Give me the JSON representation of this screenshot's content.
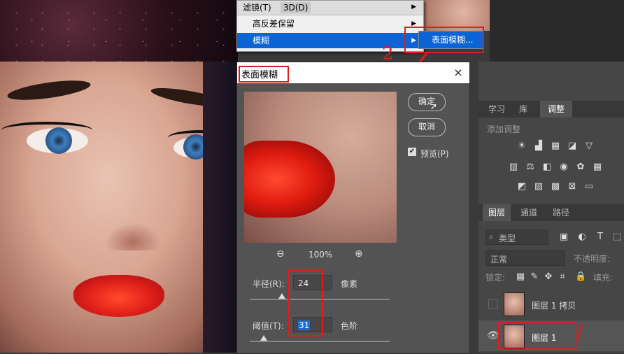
{
  "menu": {
    "filter_label": "滤镜(T)",
    "threed_label": "3D(D)",
    "items": [
      {
        "label": "高反差保留"
      },
      {
        "label": "模糊"
      }
    ],
    "submenu_label": "表面模糊..."
  },
  "annotations": {
    "step_two": "2",
    "layer_mark": "/"
  },
  "dialog": {
    "title": "表面模糊",
    "close": "×",
    "ok_label": "确定",
    "cancel_label": "取消",
    "preview_label": "预览(P)",
    "preview_checked": true,
    "zoom_out": "⊖",
    "zoom_in": "⊕",
    "zoom_level": "100%",
    "radius_label": "半径(R):",
    "radius_value": "24",
    "radius_unit": "像素",
    "radius_slider_fraction": 0.23,
    "threshold_label": "阈值(T):",
    "threshold_value": "31",
    "threshold_unit": "色阶",
    "threshold_slider_fraction": 0.1
  },
  "panels": {
    "tabs_top": [
      "学习",
      "库",
      "调整"
    ],
    "active_top_tab": "调整",
    "add_adjustment": "添加调整",
    "tabs_layers": [
      "图层",
      "通道",
      "路径"
    ],
    "active_layers_tab": "图层",
    "filter_kind": "类型",
    "blend_mode": "正常",
    "opacity_label": "不透明度:",
    "lock_label": "锁定:",
    "fill_label": "填充:",
    "layers": [
      {
        "name": "图层 1 拷贝",
        "visible": false
      },
      {
        "name": "图层 1",
        "visible": true
      }
    ]
  },
  "colors": {
    "annotation_red": "#e31b1b",
    "menu_highlight": "#0a64d6",
    "dialog_bg": "#535353"
  }
}
